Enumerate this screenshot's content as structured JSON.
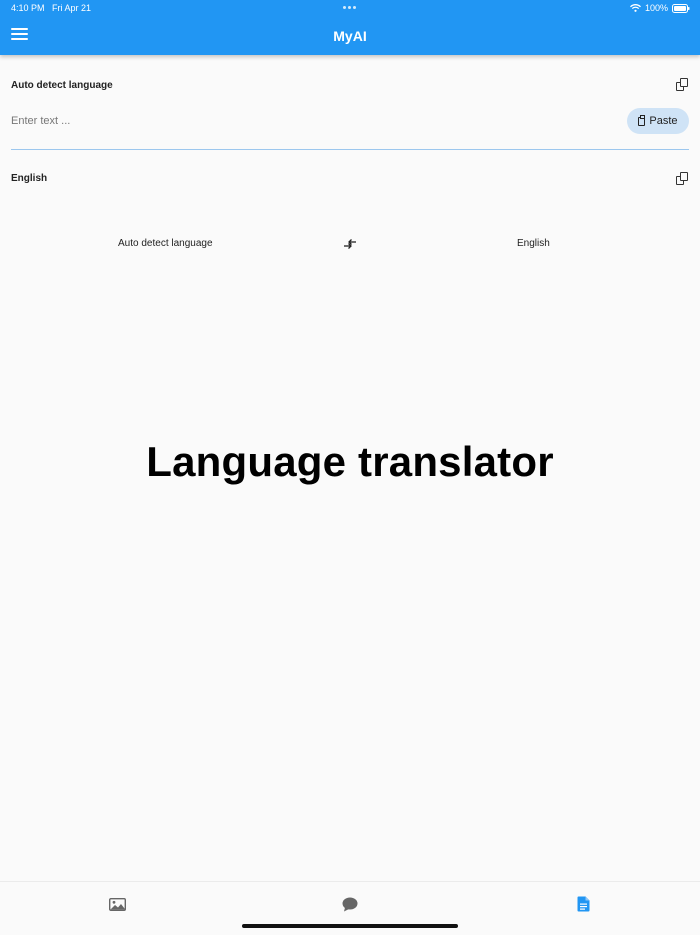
{
  "status_bar": {
    "time": "4:10 PM",
    "date": "Fri Apr 21",
    "battery": "100%"
  },
  "app_bar": {
    "title": "MyAI"
  },
  "source": {
    "language": "Auto detect language",
    "input_placeholder": "Enter text ...",
    "paste_label": "Paste"
  },
  "target": {
    "language": "English"
  },
  "selector": {
    "from": "Auto detect language",
    "to": "English"
  },
  "hero": {
    "text": "Language translator"
  },
  "colors": {
    "accent": "#2196f3",
    "paste_bg": "#cfe3f6",
    "divider": "#9cc7ee"
  },
  "bottom_nav": {
    "tabs": [
      {
        "icon": "image-icon",
        "active": false
      },
      {
        "icon": "chat-icon",
        "active": false
      },
      {
        "icon": "document-icon",
        "active": true
      }
    ]
  }
}
